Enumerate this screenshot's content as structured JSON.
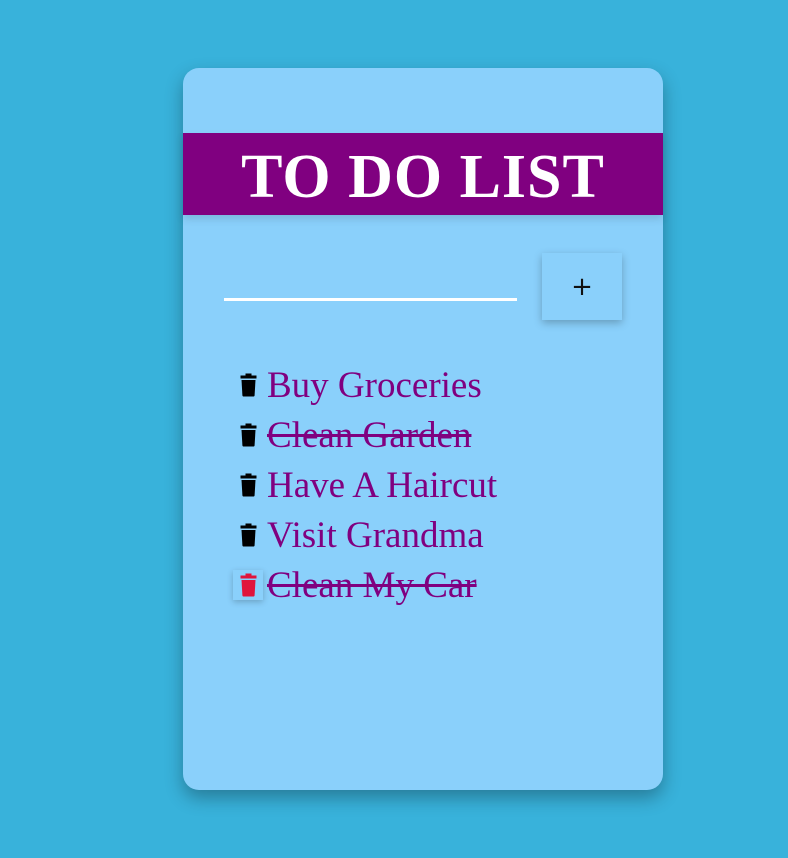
{
  "colors": {
    "page_background": "#38b2db",
    "card_background": "#8ad0fb",
    "header_background": "#800080",
    "header_text": "#ffffff",
    "item_text": "#800080",
    "trash_default": "#000000",
    "trash_hover": "#e0143c"
  },
  "header": {
    "title": "TO DO LIST"
  },
  "input": {
    "value": "",
    "placeholder": ""
  },
  "add_button": {
    "label": "+"
  },
  "todos": [
    {
      "text": "Buy Groceries",
      "completed": false,
      "icon": "trash-icon",
      "icon_state": "default"
    },
    {
      "text": "Clean Garden",
      "completed": true,
      "icon": "trash-icon",
      "icon_state": "default"
    },
    {
      "text": "Have A Haircut",
      "completed": false,
      "icon": "trash-icon",
      "icon_state": "default"
    },
    {
      "text": "Visit Grandma",
      "completed": false,
      "icon": "trash-icon",
      "icon_state": "default"
    },
    {
      "text": "Clean My Car",
      "completed": true,
      "icon": "trash-icon",
      "icon_state": "hover"
    }
  ]
}
